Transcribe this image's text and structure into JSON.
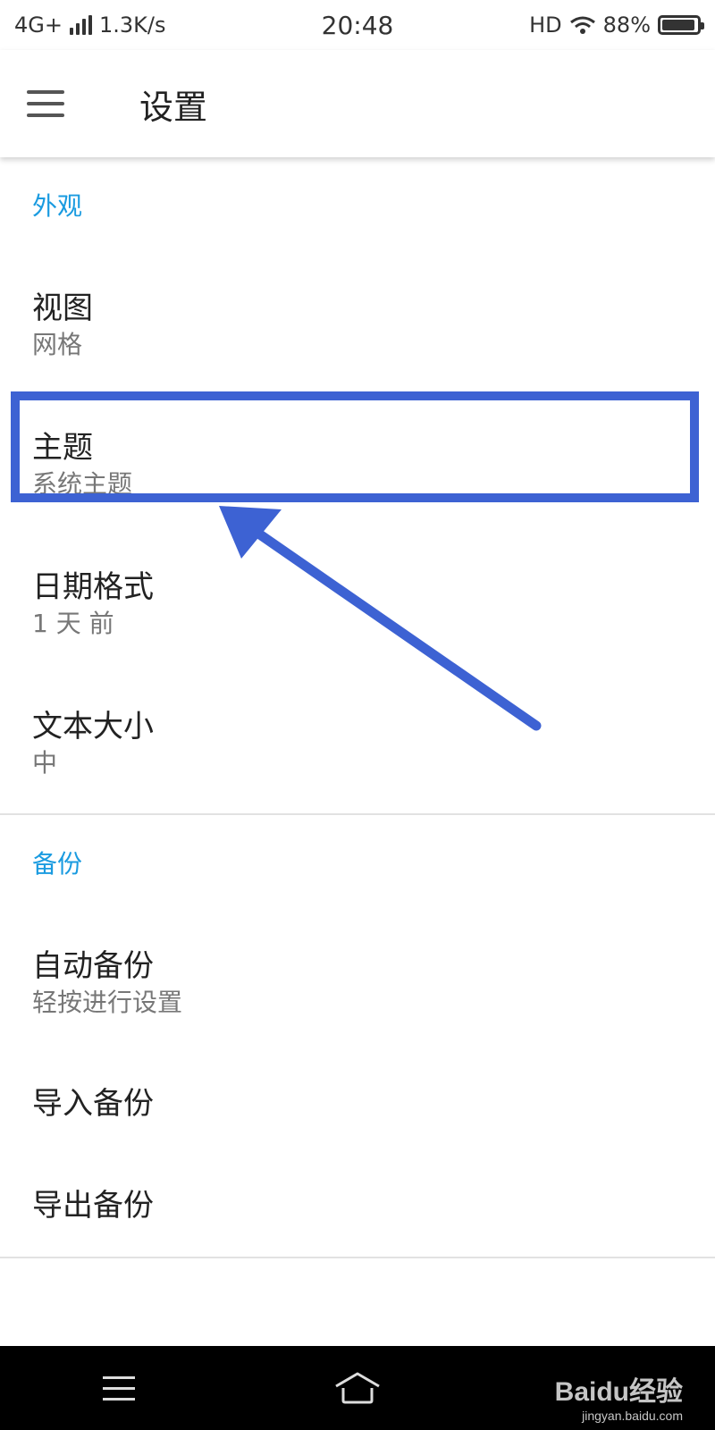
{
  "status_bar": {
    "network": "4G+",
    "speed": "1.3K/s",
    "time": "20:48",
    "hd": "HD",
    "battery": "88%"
  },
  "app_bar": {
    "title": "设置",
    "menu_icon": "hamburger-menu-icon"
  },
  "sections": [
    {
      "header": "外观",
      "items": [
        {
          "title": "视图",
          "subtitle": "网格"
        },
        {
          "title": "主题",
          "subtitle": "系统主题"
        },
        {
          "title": "日期格式",
          "subtitle": "1 天 前"
        },
        {
          "title": "文本大小",
          "subtitle": "中"
        }
      ]
    },
    {
      "header": "备份",
      "items": [
        {
          "title": "自动备份",
          "subtitle": "轻按进行设置"
        },
        {
          "title": "导入备份"
        },
        {
          "title": "导出备份"
        }
      ]
    }
  ],
  "nav_bar": {
    "recent_icon": "recent-apps-icon",
    "home_icon": "home-icon",
    "watermark_brand": "Baidu经验",
    "watermark_url": "jingyan.baidu.com"
  },
  "colors": {
    "accent": "#1a9be0",
    "annotation": "#3d62d3",
    "nav_background": "#000000"
  },
  "annotation": {
    "highlighted_item": "主题"
  }
}
